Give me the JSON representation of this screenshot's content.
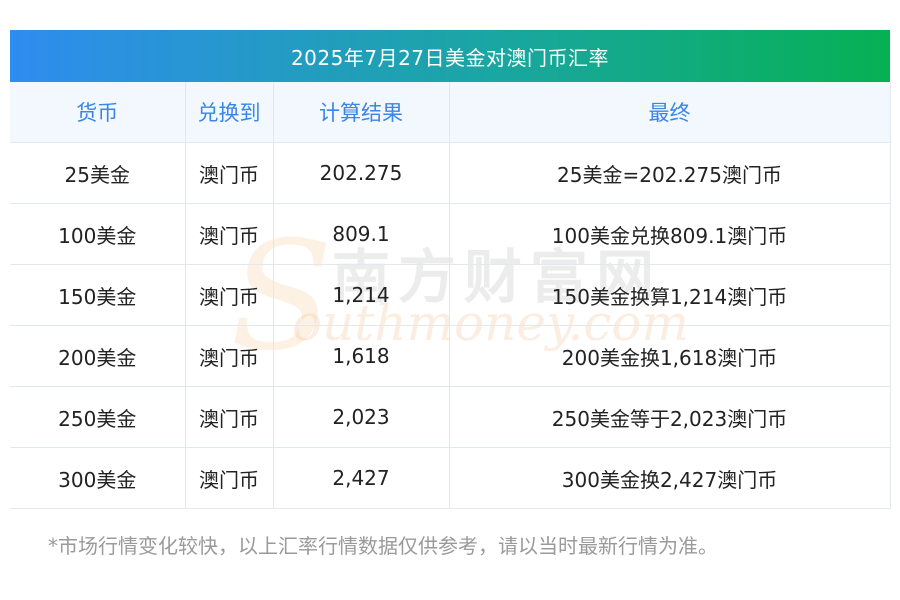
{
  "title": "2025年7月27日美金对澳门币汇率",
  "headers": [
    "货币",
    "兑换到",
    "计算结果",
    "最终"
  ],
  "rows": [
    {
      "currency": "25美金",
      "target": "澳门币",
      "result": "202.275",
      "final": "25美金=202.275澳门币"
    },
    {
      "currency": "100美金",
      "target": "澳门币",
      "result": "809.1",
      "final": "100美金兑换809.1澳门币"
    },
    {
      "currency": "150美金",
      "target": "澳门币",
      "result": "1,214",
      "final": "150美金换算1,214澳门币"
    },
    {
      "currency": "200美金",
      "target": "澳门币",
      "result": "1,618",
      "final": "200美金换1,618澳门币"
    },
    {
      "currency": "250美金",
      "target": "澳门币",
      "result": "2,023",
      "final": "250美金等于2,023澳门币"
    },
    {
      "currency": "300美金",
      "target": "澳门币",
      "result": "2,427",
      "final": "300美金换2,427澳门币"
    }
  ],
  "watermark": {
    "cn": "南方财富网",
    "en": "outhmoney.com",
    "letter": "S"
  },
  "footnote": "*市场行情变化较快，以上汇率行情数据仅供参考，请以当时最新行情为准。",
  "colors": {
    "title_start": "#2f8cf0",
    "title_end": "#06b153",
    "header_text": "#3a86e6",
    "header_bg": "#f2f8fe"
  }
}
